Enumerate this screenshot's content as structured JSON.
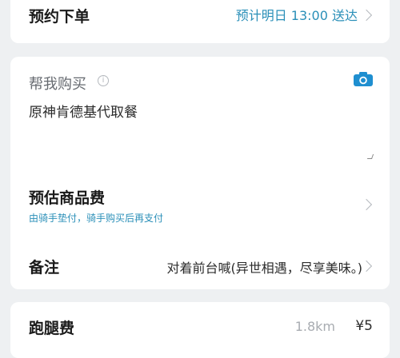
{
  "order": {
    "title": "预约下单",
    "value": "预计明日 13:00 送达"
  },
  "purchase": {
    "label": "帮我购买",
    "info_icon": "info-circle-icon",
    "camera_icon": "camera-icon",
    "text": "原神肯德基代取餐"
  },
  "goods_fee": {
    "title": "预估商品费",
    "subtitle": "由骑手垫付，骑手购买后再支付"
  },
  "note": {
    "title": "备注",
    "value": "对着前台喊(异世相遇，尽享美味。)"
  },
  "errand_fee": {
    "title": "跑腿费",
    "distance": "1.8km",
    "price": "¥5"
  },
  "colors": {
    "accent": "#2a8fb8",
    "camera": "#1f8fd0",
    "background": "#eef0f2"
  }
}
